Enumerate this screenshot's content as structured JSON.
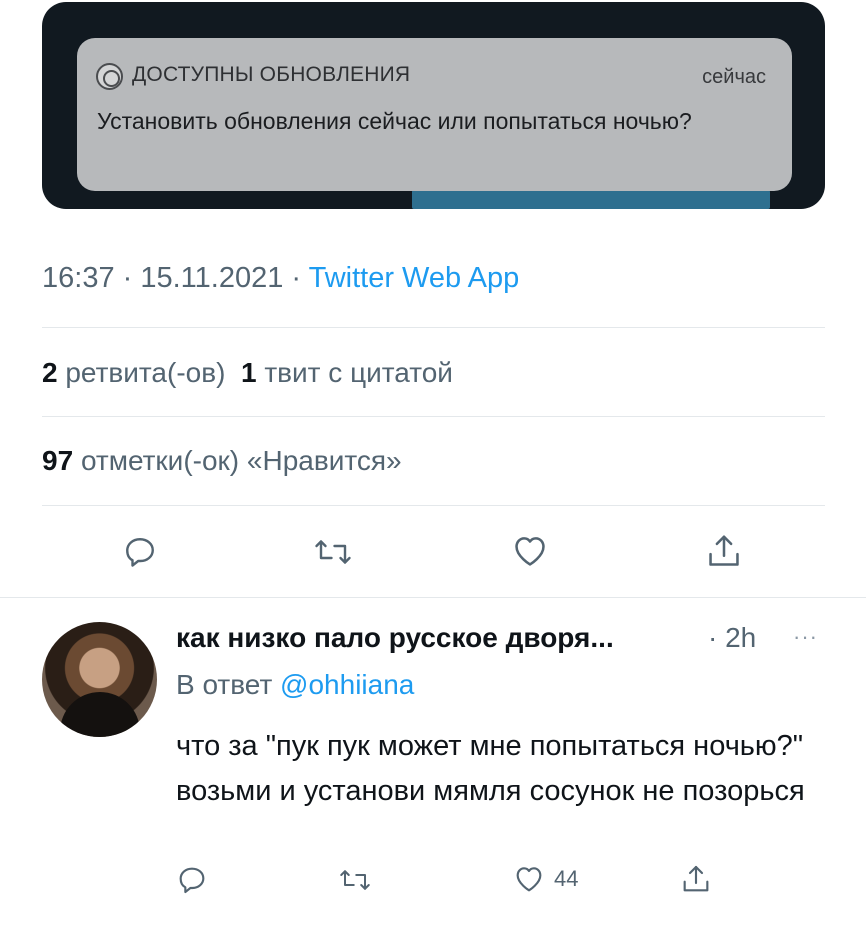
{
  "notification": {
    "app_name": "ДОСТУПНЫ ОБНОВЛЕНИЯ",
    "time": "сейчас",
    "body": "Установить обновления сейчас или попытаться ночью?"
  },
  "tweet": {
    "timestamp": "16:37 · 15.11.2021 · ",
    "source": "Twitter Web App",
    "retweets_count": "2",
    "retweets_label": "ретвита(-ов)",
    "quotes_count": "1",
    "quotes_label": "твит с цитатой",
    "likes_count": "97",
    "likes_label": "отметки(-ок) «Нравится»"
  },
  "reply": {
    "author_name": "как низко пало русское дворя...",
    "time": "· 2h",
    "more": "···",
    "reply_prefix": "В ответ ",
    "reply_handle": "@ohhiiana",
    "text": "что за \"пук пук может мне попытаться ночью?\" возьми и установи мямля сосунок не позорься",
    "like_count": "44"
  },
  "colors": {
    "accent": "#1d9bf0",
    "secondary_text": "#536471",
    "icon": "#536471"
  },
  "icons": [
    "reply-icon",
    "retweet-icon",
    "like-icon",
    "share-icon",
    "more-icon"
  ]
}
